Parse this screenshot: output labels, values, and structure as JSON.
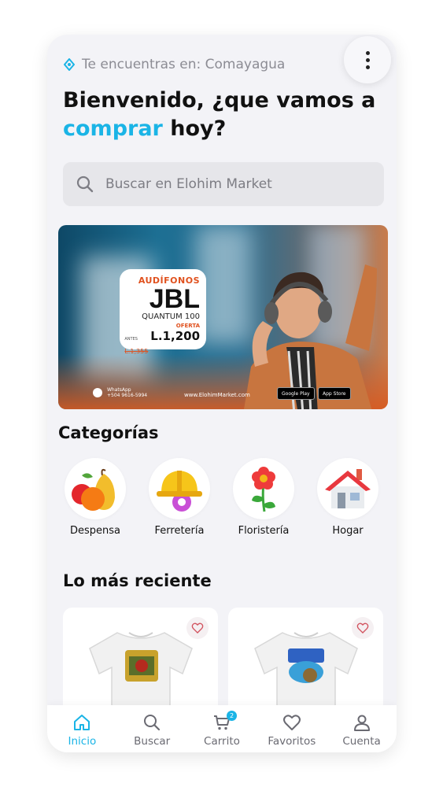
{
  "location": {
    "text": "Te encuentras en: Comayagua"
  },
  "headline": {
    "line1": "Bienvenido, ¿que vamos a",
    "accent": "comprar",
    "rest": " hoy?"
  },
  "search": {
    "placeholder": "Buscar en Elohim Market"
  },
  "banner": {
    "tag": "AUDÍFONOS",
    "brand": "JBL",
    "model": "QUANTUM 100",
    "offer_label": "OFERTA",
    "before_label": "ANTES",
    "old_price": "L.1,355",
    "new_price": "L.1,200",
    "whatsapp_label": "WhatsApp",
    "whatsapp_number": "+504 9616-5994",
    "url": "www.ElohimMarket.com",
    "google_play": "Google Play",
    "app_store": "App Store"
  },
  "categories": {
    "title": "Categorías",
    "items": [
      {
        "label": "Despensa",
        "icon": "fruit-icon"
      },
      {
        "label": "Ferretería",
        "icon": "hard-hat-icon"
      },
      {
        "label": "Floristería",
        "icon": "flower-icon"
      },
      {
        "label": "Hogar",
        "icon": "house-icon"
      }
    ]
  },
  "recent": {
    "title": "Lo más reciente"
  },
  "products": [
    {
      "icon": "tshirt-icon",
      "favorite": false
    },
    {
      "icon": "tshirt-icon",
      "favorite": false
    }
  ],
  "tabbar": {
    "items": [
      {
        "label": "Inicio",
        "icon": "home-icon",
        "active": true
      },
      {
        "label": "Buscar",
        "icon": "search-icon",
        "active": false
      },
      {
        "label": "Carrito",
        "icon": "cart-icon",
        "active": false,
        "badge": "2"
      },
      {
        "label": "Favoritos",
        "icon": "heart-icon",
        "active": false
      },
      {
        "label": "Cuenta",
        "icon": "user-icon",
        "active": false
      }
    ]
  },
  "colors": {
    "accent": "#1ab4e6",
    "background": "#f3f3f7",
    "text": "#111111"
  }
}
